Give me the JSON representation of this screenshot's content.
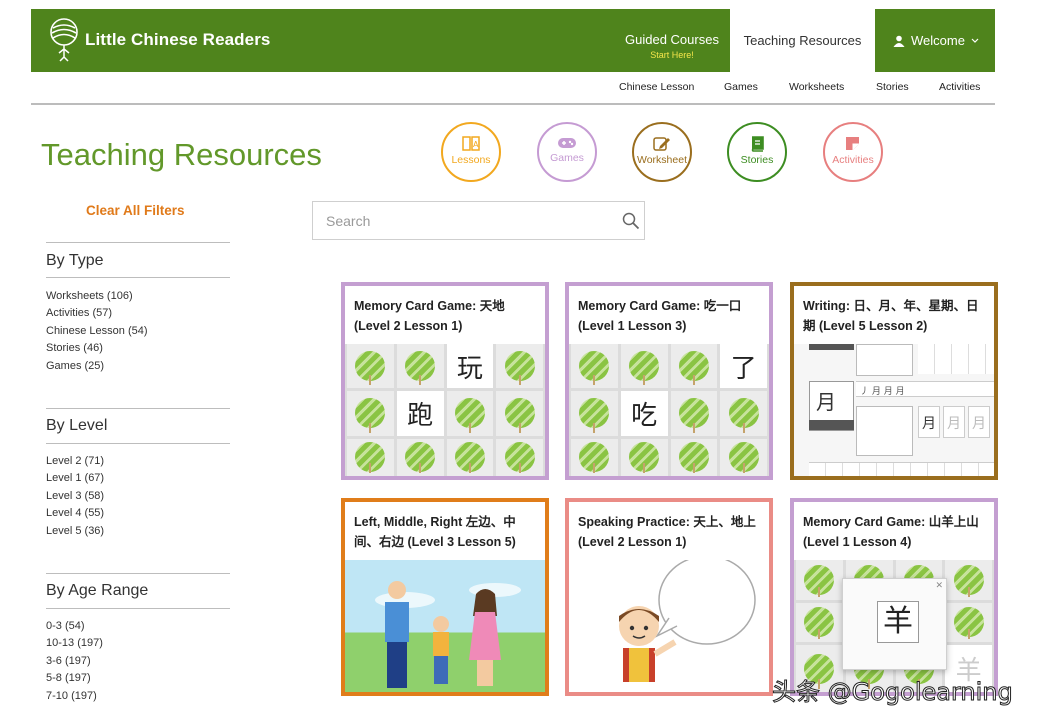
{
  "brand": {
    "name": "Little Chinese Readers",
    "color": "#4f841c"
  },
  "nav": {
    "guided_label": "Guided Courses",
    "guided_sub": "Start Here!",
    "teaching_label": "Teaching Resources",
    "welcome_label": "Welcome"
  },
  "subnav": [
    "Chinese Lesson",
    "Games",
    "Worksheets",
    "Stories",
    "Activities"
  ],
  "page_title": "Teaching Resources",
  "categories": [
    {
      "label": "Lessons",
      "color": "#f2a81f",
      "icon": "book-a-icon"
    },
    {
      "label": "Games",
      "color": "#c59bd3",
      "icon": "gamepad-icon"
    },
    {
      "label": "Worksheet",
      "color": "#9a6e1e",
      "icon": "pencil-edit-icon"
    },
    {
      "label": "Stories",
      "color": "#3d8d22",
      "icon": "stories-book-icon"
    },
    {
      "label": "Activities",
      "color": "#e77f7f",
      "icon": "puzzle-icon"
    }
  ],
  "search": {
    "placeholder": "Search"
  },
  "filters": {
    "clear_label": "Clear All Filters",
    "groups": [
      {
        "title": "By Type",
        "items": [
          "Worksheets (106)",
          "Activities (57)",
          "Chinese Lesson (54)",
          "Stories (46)",
          "Games (25)"
        ]
      },
      {
        "title": "By Level",
        "items": [
          "Level 2 (71)",
          "Level 1 (67)",
          "Level 3 (58)",
          "Level 4 (55)",
          "Level 5 (36)"
        ]
      },
      {
        "title": "By Age Range",
        "items": [
          "0-3 (54)",
          "10-13 (197)",
          "3-6 (197)",
          "5-8 (197)",
          "7-10 (197)"
        ]
      }
    ]
  },
  "cards": [
    {
      "title": "Memory Card Game: 天地 (Level 2 Lesson 1)",
      "color": "#c49fd1",
      "chars": [
        "玩",
        "跑"
      ]
    },
    {
      "title": "Memory Card Game: 吃一口 (Level 1 Lesson 3)",
      "color": "#c49fd1",
      "chars": [
        "了",
        "吃"
      ]
    },
    {
      "title": "Writing: 日、月、年、星期、日期 (Level 5 Lesson 2)",
      "color": "#9a6e1e",
      "chars": [
        "月",
        "月",
        "月",
        "月"
      ]
    },
    {
      "title": "Left, Middle, Right 左边、中间、右边 (Level 3 Lesson 5)",
      "color": "#e07d1a"
    },
    {
      "title": "Speaking Practice: 天上、地上 (Level 2 Lesson 1)",
      "color": "#ea8c86"
    },
    {
      "title": "Memory Card Game: 山羊上山 (Level 1 Lesson 4)",
      "color": "#c49fd1",
      "chars": [
        "羊",
        "羊"
      ]
    }
  ],
  "watermark": "头条 @Gogolearning"
}
